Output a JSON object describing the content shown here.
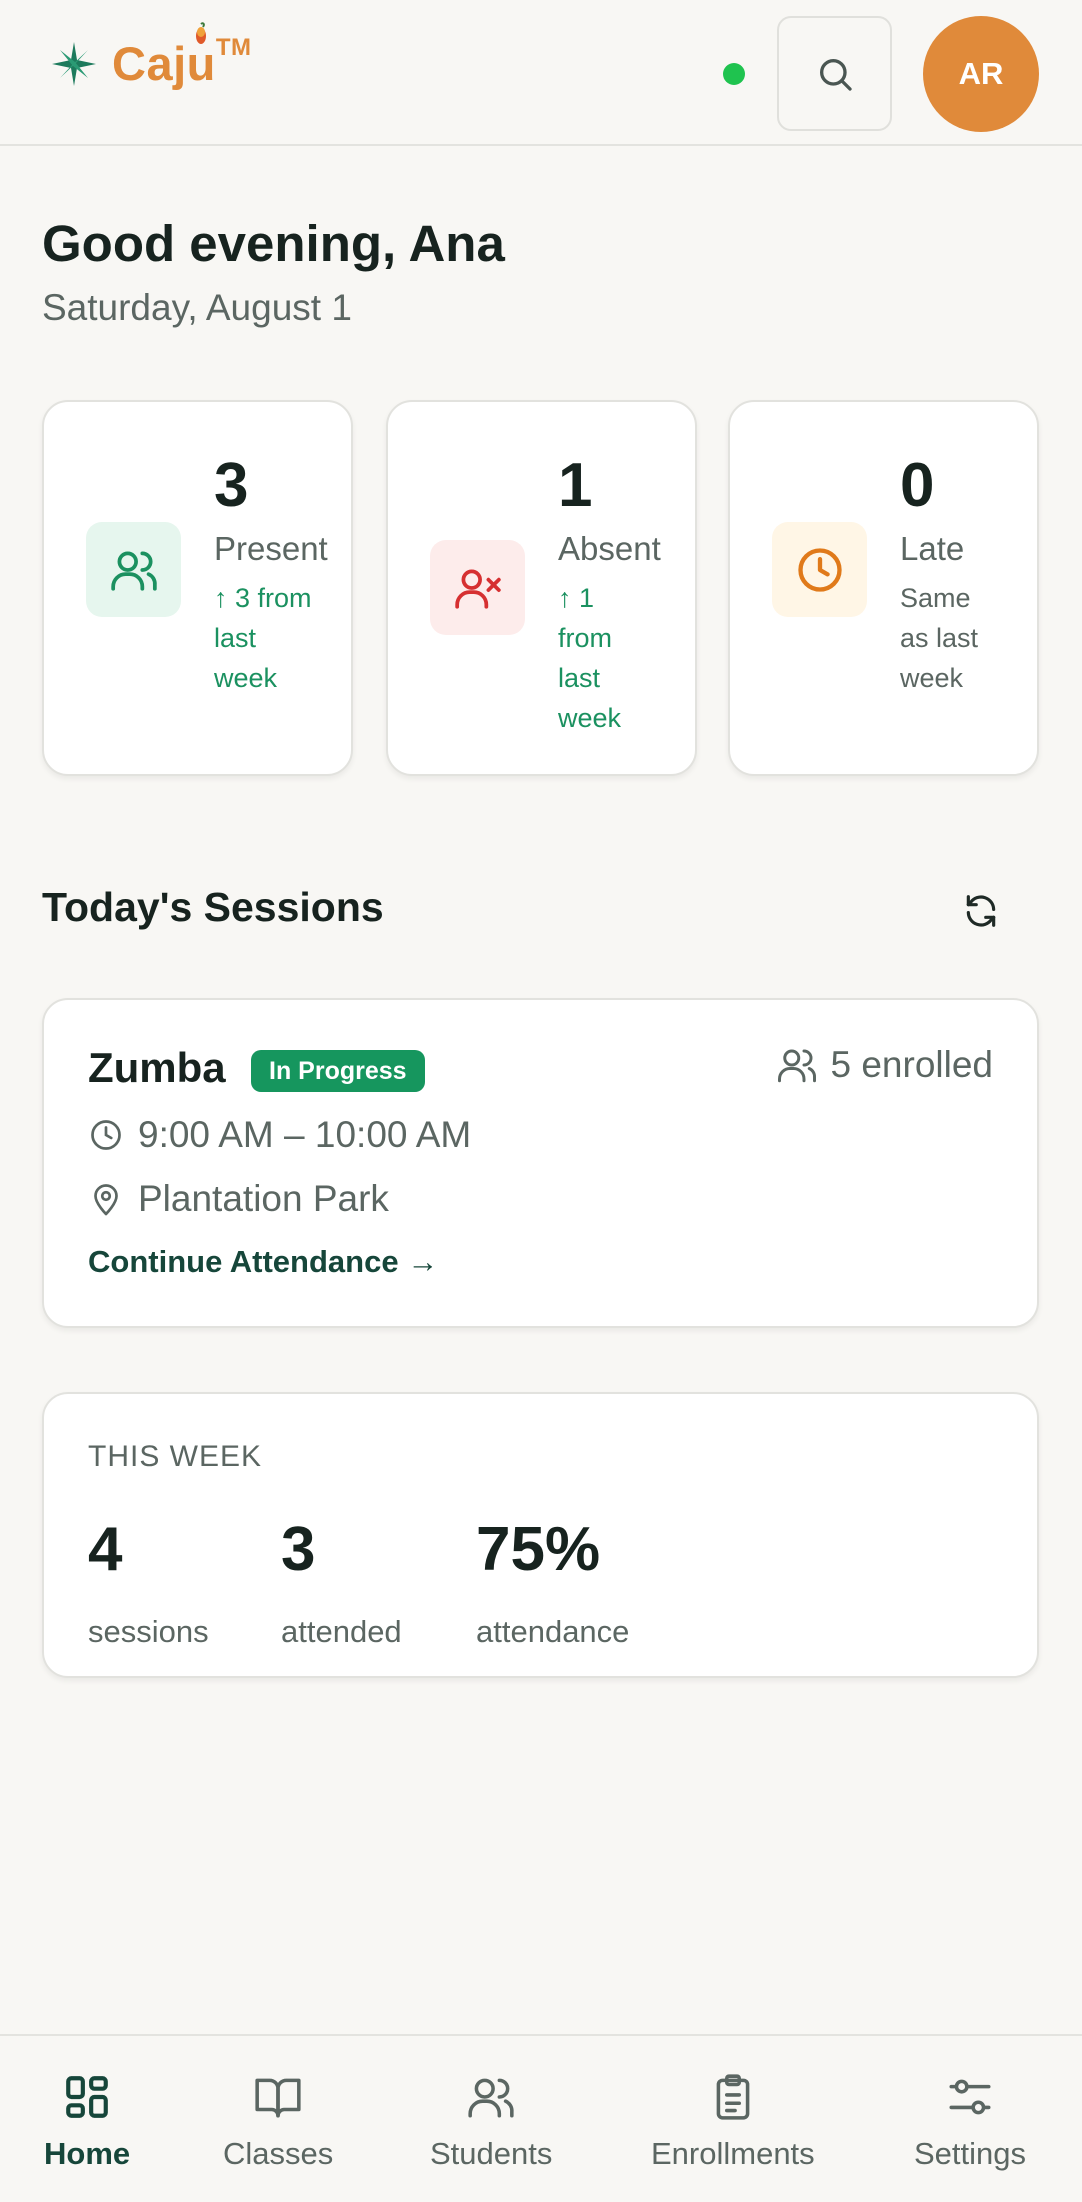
{
  "header": {
    "brand": "Caju",
    "trademark": "TM",
    "avatar_initials": "AR",
    "status_color": "#1fc34f",
    "search_icon": "search-icon"
  },
  "greeting": {
    "title": "Good evening, Ana",
    "date": "Saturday, August 1"
  },
  "stats": [
    {
      "value": "3",
      "label": "Present",
      "change": "↑ 3 from\nlast\nweek",
      "icon": "users-icon",
      "color": "#1b9160"
    },
    {
      "value": "1",
      "label": "Absent",
      "change": "↑ 1\nfrom\nlast\nweek",
      "icon": "user-x-icon",
      "color": "#d63031"
    },
    {
      "value": "0",
      "label": "Late",
      "change": "Same\nas last\nweek",
      "icon": "clock-icon",
      "color": "#e07a1a"
    }
  ],
  "sessions": {
    "title": "Today's Sessions",
    "items": [
      {
        "name": "Zumba",
        "status": "In Progress",
        "enrolled": "5 enrolled",
        "time": "9:00 AM – 10:00 AM",
        "location": "Plantation Park",
        "action": "Continue Attendance →"
      }
    ]
  },
  "week": {
    "title": "THIS WEEK",
    "stats": [
      {
        "value": "4",
        "label": "sessions"
      },
      {
        "value": "3",
        "label": "attended"
      },
      {
        "value": "75%",
        "label": "attendance"
      }
    ]
  },
  "nav": {
    "items": [
      {
        "label": "Home",
        "icon": "grid-icon",
        "active": true
      },
      {
        "label": "Classes",
        "icon": "book-icon",
        "active": false
      },
      {
        "label": "Students",
        "icon": "users-icon",
        "active": false
      },
      {
        "label": "Enrollments",
        "icon": "clipboard-icon",
        "active": false
      },
      {
        "label": "Settings",
        "icon": "sliders-icon",
        "active": false
      }
    ]
  }
}
